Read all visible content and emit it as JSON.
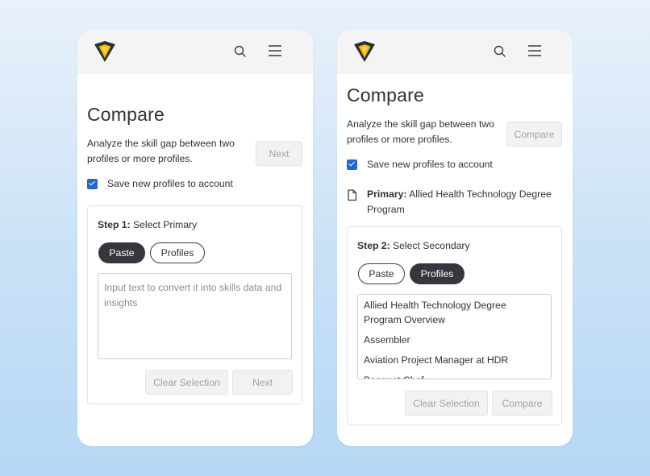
{
  "colors": {
    "accent_yellow": "#f5b800",
    "logo_dark": "#2b2f36",
    "checkbox_blue": "#2867c7",
    "pill_dark": "#35373c"
  },
  "icons": {
    "logo": "shield-v-logo",
    "search": "search-icon",
    "menu": "hamburger-menu-icon",
    "document": "document-icon",
    "checkbox": "checkbox-checked"
  },
  "left": {
    "title": "Compare",
    "intro": "Analyze the skill gap between two profiles or more profiles.",
    "next_button": "Next",
    "save_checkbox": {
      "checked": true,
      "label": "Save new profiles to account"
    },
    "step": {
      "label_bold": "Step 1:",
      "label_text": " Select Primary",
      "tabs": [
        {
          "label": "Paste",
          "active": true
        },
        {
          "label": "Profiles",
          "active": false
        }
      ],
      "textarea_placeholder": "Input text to convert it into skills data and insights",
      "clear_button": "Clear Selection",
      "next_button": "Next"
    }
  },
  "right": {
    "title": "Compare",
    "intro": "Analyze the skill gap between two profiles or more profiles.",
    "compare_button": "Compare",
    "save_checkbox": {
      "checked": true,
      "label": "Save new profiles to account"
    },
    "primary": {
      "label": "Primary:",
      "value": " Allied Health Technology Degree Program"
    },
    "step": {
      "label_bold": "Step 2:",
      "label_text": " Select Secondary",
      "tabs": [
        {
          "label": "Paste",
          "active": false
        },
        {
          "label": "Profiles",
          "active": true
        }
      ],
      "profiles": [
        "Allied Health Technology Degree Program Overview",
        "Assembler",
        "Aviation Project Manager at HDR",
        "Banquet Chef"
      ],
      "clear_button": "Clear Selection",
      "compare_button": "Compare"
    }
  }
}
